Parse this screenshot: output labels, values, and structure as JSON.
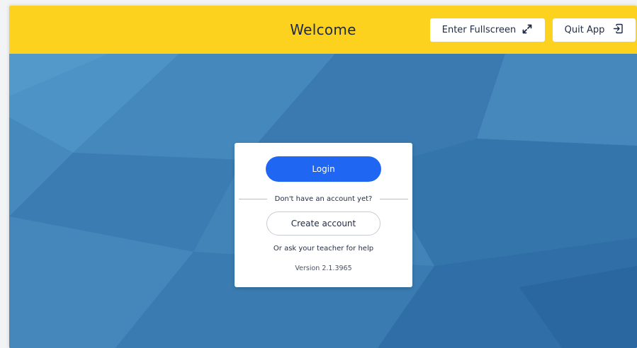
{
  "header": {
    "title": "Welcome",
    "fullscreen_label": "Enter Fullscreen",
    "fullscreen_icon": "expand-arrows-icon",
    "quit_label": "Quit App",
    "quit_icon": "exit-icon"
  },
  "login_card": {
    "login_label": "Login",
    "divider_text": "Don't have an account yet?",
    "create_label": "Create account",
    "help_text": "Or ask your teacher for help",
    "version_text": "Version 2.1.3965"
  },
  "colors": {
    "header_bg": "#fcd21f",
    "background_blue": "#3e80b5",
    "primary_button": "#1f66f2"
  }
}
